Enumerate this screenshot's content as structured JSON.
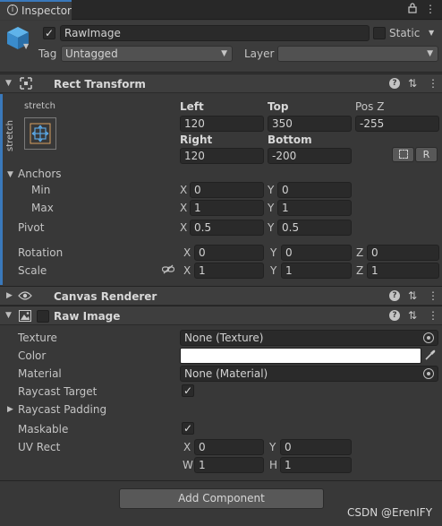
{
  "window": {
    "tab_title": "Inspector"
  },
  "header": {
    "enabled": true,
    "object_name": "RawImage",
    "static_label": "Static",
    "static_checked": false,
    "tag_label": "Tag",
    "tag_value": "Untagged",
    "layer_label": "Layer",
    "layer_value": ""
  },
  "rect_transform": {
    "title": "Rect Transform",
    "anchor_preset_h": "stretch",
    "anchor_preset_v": "stretch",
    "left_label": "Left",
    "left": "120",
    "top_label": "Top",
    "top": "350",
    "posz_label": "Pos Z",
    "posz": "-255",
    "right_label": "Right",
    "right": "120",
    "bottom_label": "Bottom",
    "bottom": "-200",
    "r_button": "R",
    "anchors_label": "Anchors",
    "min_label": "Min",
    "min_x": "0",
    "min_y": "0",
    "max_label": "Max",
    "max_x": "1",
    "max_y": "1",
    "pivot_label": "Pivot",
    "pivot_x": "0.5",
    "pivot_y": "0.5",
    "rotation_label": "Rotation",
    "rot_x": "0",
    "rot_y": "0",
    "rot_z": "0",
    "scale_label": "Scale",
    "scale_x": "1",
    "scale_y": "1",
    "scale_z": "1",
    "axis_x": "X",
    "axis_y": "Y",
    "axis_z": "Z"
  },
  "canvas_renderer": {
    "title": "Canvas Renderer"
  },
  "raw_image": {
    "title": "Raw Image",
    "enabled": false,
    "texture_label": "Texture",
    "texture_value": "None (Texture)",
    "color_label": "Color",
    "color_value": "#ffffff",
    "material_label": "Material",
    "material_value": "None (Material)",
    "raycast_target_label": "Raycast Target",
    "raycast_target_checked": true,
    "raycast_padding_label": "Raycast Padding",
    "maskable_label": "Maskable",
    "maskable_checked": true,
    "uvrect_label": "UV Rect",
    "uv_x": "0",
    "uv_y": "0",
    "uv_w": "1",
    "uv_h": "1",
    "axis_w": "W",
    "axis_h": "H"
  },
  "footer": {
    "add_component": "Add Component",
    "watermark": "CSDN @ErenIFY"
  },
  "icons": {
    "check": "✓",
    "lock": "🔒",
    "menu": "⋮",
    "foldout_open": "▼",
    "foldout_closed": "▶",
    "help": "?",
    "preset": "⇅",
    "picker": "⦿",
    "eyedropper": "✎",
    "link": "∞"
  },
  "colors": {
    "accent": "#3a79bb",
    "panel": "#383838",
    "header": "#3e3e3e",
    "field": "#2a2a2a"
  }
}
